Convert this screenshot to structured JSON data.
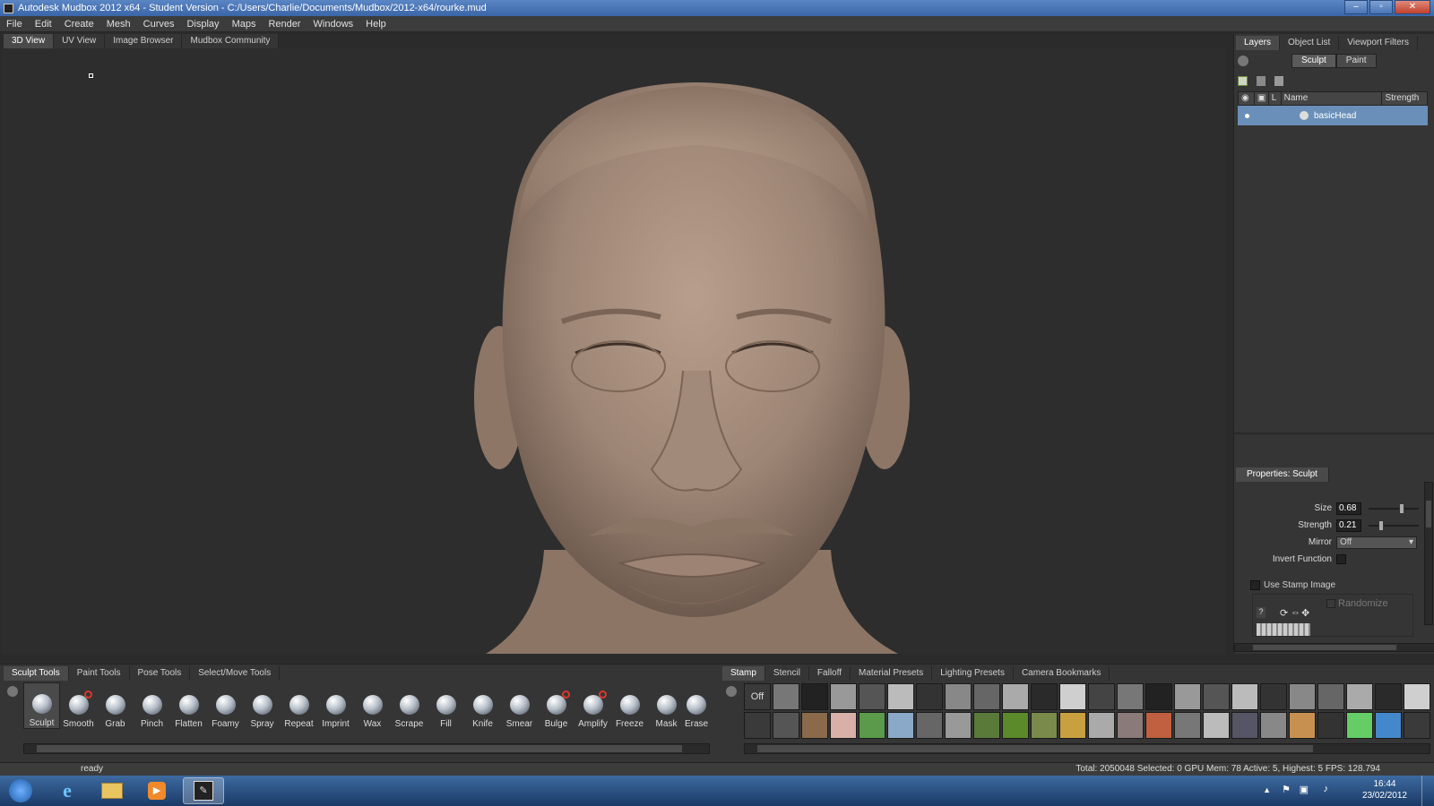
{
  "window": {
    "title": "Autodesk Mudbox 2012 x64 - Student Version - C:/Users/Charlie/Documents/Mudbox/2012-x64/rourke.mud"
  },
  "menu": [
    "File",
    "Edit",
    "Create",
    "Mesh",
    "Curves",
    "Display",
    "Maps",
    "Render",
    "Windows",
    "Help"
  ],
  "view_tabs": [
    "3D View",
    "UV View",
    "Image Browser",
    "Mudbox Community"
  ],
  "right_panel": {
    "tabs": [
      "Layers",
      "Object List",
      "Viewport Filters"
    ],
    "mode_buttons": [
      "Sculpt",
      "Paint"
    ],
    "layer_columns": {
      "visibility": "",
      "lock": "",
      "l": "L",
      "name": "Name",
      "strength": "Strength"
    },
    "layers": [
      {
        "name": "basicHead"
      }
    ]
  },
  "properties": {
    "title": "Properties: Sculpt",
    "size_label": "Size",
    "size_value": "0.68",
    "size_fraction": 0.68,
    "strength_label": "Strength",
    "strength_value": "0.21",
    "strength_fraction": 0.21,
    "mirror_label": "Mirror",
    "mirror_value": "Off",
    "invert_label": "Invert Function",
    "use_stamp_label": "Use Stamp Image",
    "randomize_label": "Randomize"
  },
  "tool_tabs": [
    "Sculpt Tools",
    "Paint Tools",
    "Pose Tools",
    "Select/Move Tools"
  ],
  "tools": [
    "Sculpt",
    "Smooth",
    "Grab",
    "Pinch",
    "Flatten",
    "Foamy",
    "Spray",
    "Repeat",
    "Imprint",
    "Wax",
    "Scrape",
    "Fill",
    "Knife",
    "Smear",
    "Bulge",
    "Amplify",
    "Freeze",
    "Mask",
    "Erase"
  ],
  "tray_tabs": [
    "Stamp",
    "Stencil",
    "Falloff",
    "Material Presets",
    "Lighting Presets",
    "Camera Bookmarks"
  ],
  "stamp_off_label": "Off",
  "status": {
    "left": "ready",
    "right": "Total: 2050048  Selected: 0 GPU Mem: 78  Active: 5, Highest: 5  FPS: 128.794"
  },
  "taskbar": {
    "time": "16:44",
    "date": "23/02/2012"
  },
  "colors": {
    "accent": "#6a8fb8",
    "viewport_bg": "#2d2d2d",
    "clay": "#a48d7c"
  }
}
